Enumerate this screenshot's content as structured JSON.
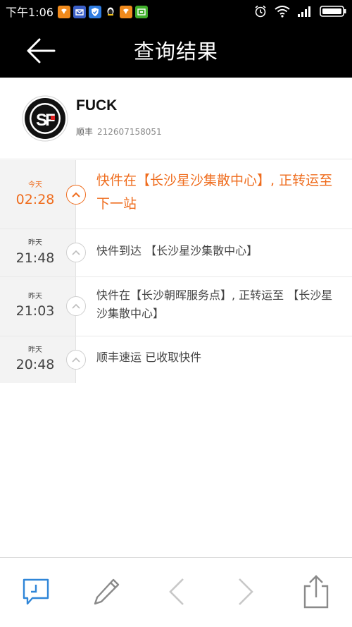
{
  "status_bar": {
    "time": "下午1:06",
    "app_icons": [
      "uc-browser-icon",
      "mail-icon",
      "shield-icon",
      "qq-icon",
      "uc-browser-icon",
      "iqiyi-icon"
    ],
    "app_colors": [
      "#f08a1c",
      "#3b5fc7",
      "#2f7de1",
      "#ffffff",
      "#f08a1c",
      "#3fae2a"
    ],
    "right_icons": [
      "alarm-icon",
      "wifi-icon",
      "signal-icon",
      "battery-icon"
    ]
  },
  "header": {
    "title": "查询结果",
    "back_icon": "back-arrow-icon"
  },
  "carrier": {
    "name": "FUCK",
    "company": "顺丰",
    "tracking_number": "212607158051",
    "logo": "sf-express-logo"
  },
  "events": [
    {
      "day": "今天",
      "time": "02:28",
      "description": "快件在【长沙星沙集散中心】, 正转运至下一站",
      "active": true
    },
    {
      "day": "昨天",
      "time": "21:48",
      "description": "快件到达 【长沙星沙集散中心】",
      "active": false
    },
    {
      "day": "昨天",
      "time": "21:03",
      "description": "快件在【长沙朝晖服务点】, 正转运至 【长沙星沙集散中心】",
      "active": false
    },
    {
      "day": "昨天",
      "time": "20:48",
      "description": "顺丰速运 已收取快件",
      "active": false
    }
  ],
  "toolbar": {
    "items": [
      "comment-icon",
      "edit-icon",
      "previous-icon",
      "next-icon",
      "share-icon"
    ]
  },
  "colors": {
    "accent": "#ef6c1d",
    "header_background": "#000000",
    "toolbar_active": "#2f86d8",
    "toolbar_inactive": "#8a8a8a"
  }
}
